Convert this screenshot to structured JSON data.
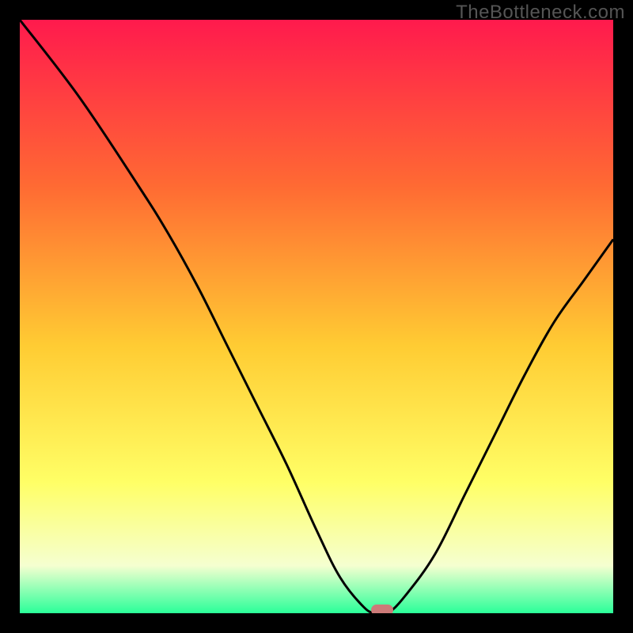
{
  "watermark": "TheBottleneck.com",
  "colors": {
    "bg_top": "#ff1a4d",
    "bg_upper_mid": "#ff6a33",
    "bg_mid": "#ffcc33",
    "bg_lower_mid": "#ffff66",
    "bg_pale": "#f5ffd0",
    "bg_bottom": "#2aff99",
    "curve": "#000000",
    "marker": "#cc7a78",
    "frame": "#000000"
  },
  "chart_data": {
    "type": "line",
    "title": "",
    "xlabel": "",
    "ylabel": "",
    "xlim": [
      0,
      100
    ],
    "ylim": [
      0,
      100
    ],
    "grid": false,
    "legend": false,
    "series": [
      {
        "name": "bottleneck-curve",
        "x": [
          0,
          10,
          20,
          25,
          30,
          35,
          40,
          45,
          50,
          54,
          58,
          60,
          62,
          65,
          70,
          75,
          80,
          85,
          90,
          95,
          100
        ],
        "values": [
          100,
          87,
          72,
          64,
          55,
          45,
          35,
          25,
          14,
          6,
          1,
          0,
          0,
          3,
          10,
          20,
          30,
          40,
          49,
          56,
          63
        ]
      }
    ],
    "annotations": [
      {
        "name": "optimal-marker",
        "x": 61,
        "y": 0.5
      }
    ]
  }
}
